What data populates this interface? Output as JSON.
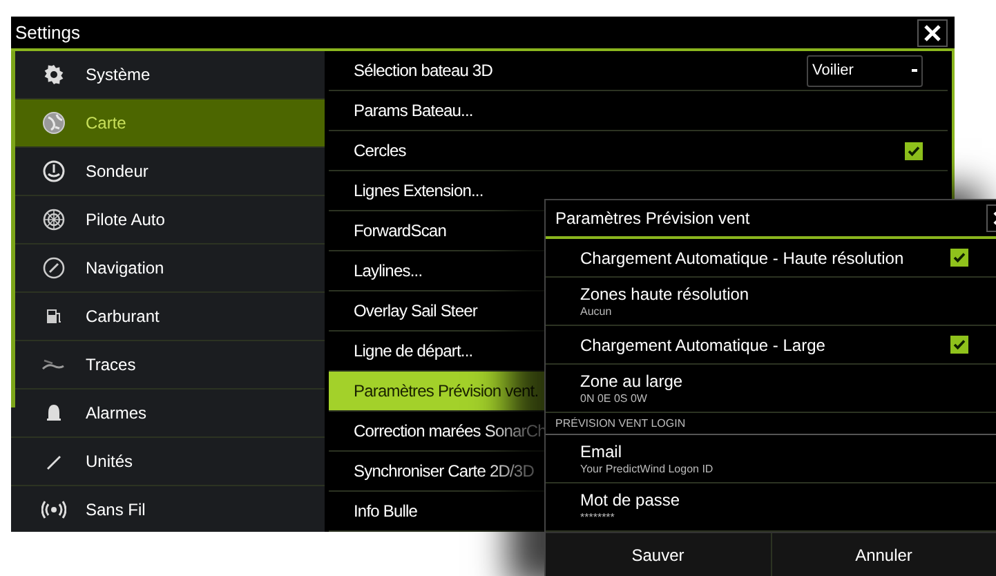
{
  "window": {
    "title": "Settings"
  },
  "sidebar": {
    "items": [
      {
        "label": "Système",
        "selected": false
      },
      {
        "label": "Carte",
        "selected": true
      },
      {
        "label": "Sondeur",
        "selected": false
      },
      {
        "label": "Pilote Auto",
        "selected": false
      },
      {
        "label": "Navigation",
        "selected": false
      },
      {
        "label": "Carburant",
        "selected": false
      },
      {
        "label": "Traces",
        "selected": false
      },
      {
        "label": "Alarmes",
        "selected": false
      },
      {
        "label": "Unités",
        "selected": false
      },
      {
        "label": "Sans Fil",
        "selected": false
      }
    ]
  },
  "main": {
    "rows": [
      {
        "kind": "dropdown",
        "label": "Sélection bateau 3D",
        "value": "Voilier",
        "selected": false
      },
      {
        "kind": "link",
        "label": "Params Bateau...",
        "selected": false
      },
      {
        "kind": "checkbox",
        "label": "Cercles",
        "checked": true,
        "selected": false
      },
      {
        "kind": "link",
        "label": "Lignes Extension...",
        "selected": false
      },
      {
        "kind": "link",
        "label": "ForwardScan",
        "selected": false
      },
      {
        "kind": "link",
        "label": "Laylines...",
        "selected": false
      },
      {
        "kind": "link",
        "label": "Overlay Sail Steer",
        "selected": false
      },
      {
        "kind": "link",
        "label": "Ligne de départ...",
        "selected": false
      },
      {
        "kind": "link",
        "label": "Paramètres Prévision vent.",
        "selected": true
      },
      {
        "kind": "link",
        "label": "Correction marées SonarCh",
        "selected": false
      },
      {
        "kind": "link",
        "label": "Synchroniser Carte 2D/3D",
        "selected": false
      },
      {
        "kind": "link",
        "label": "Info Bulle",
        "selected": false
      }
    ]
  },
  "dialog": {
    "title": "Paramètres Prévision vent",
    "rows": [
      {
        "kind": "checkbox",
        "label": "Chargement Automatique - Haute résolution",
        "checked": true
      },
      {
        "kind": "detail",
        "label": "Zones haute résolution",
        "value": "Aucun"
      },
      {
        "kind": "checkbox",
        "label": "Chargement Automatique - Large",
        "checked": true
      },
      {
        "kind": "detail",
        "label": "Zone au large",
        "value": "0N 0E 0S 0W"
      },
      {
        "kind": "section",
        "label": "PRÉVISION VENT LOGIN"
      },
      {
        "kind": "detail",
        "label": "Email",
        "value": "Your PredictWind Logon ID"
      },
      {
        "kind": "detail",
        "label": "Mot de passe",
        "value": "********"
      }
    ],
    "buttons": [
      "Sauver",
      "Annuler"
    ]
  }
}
